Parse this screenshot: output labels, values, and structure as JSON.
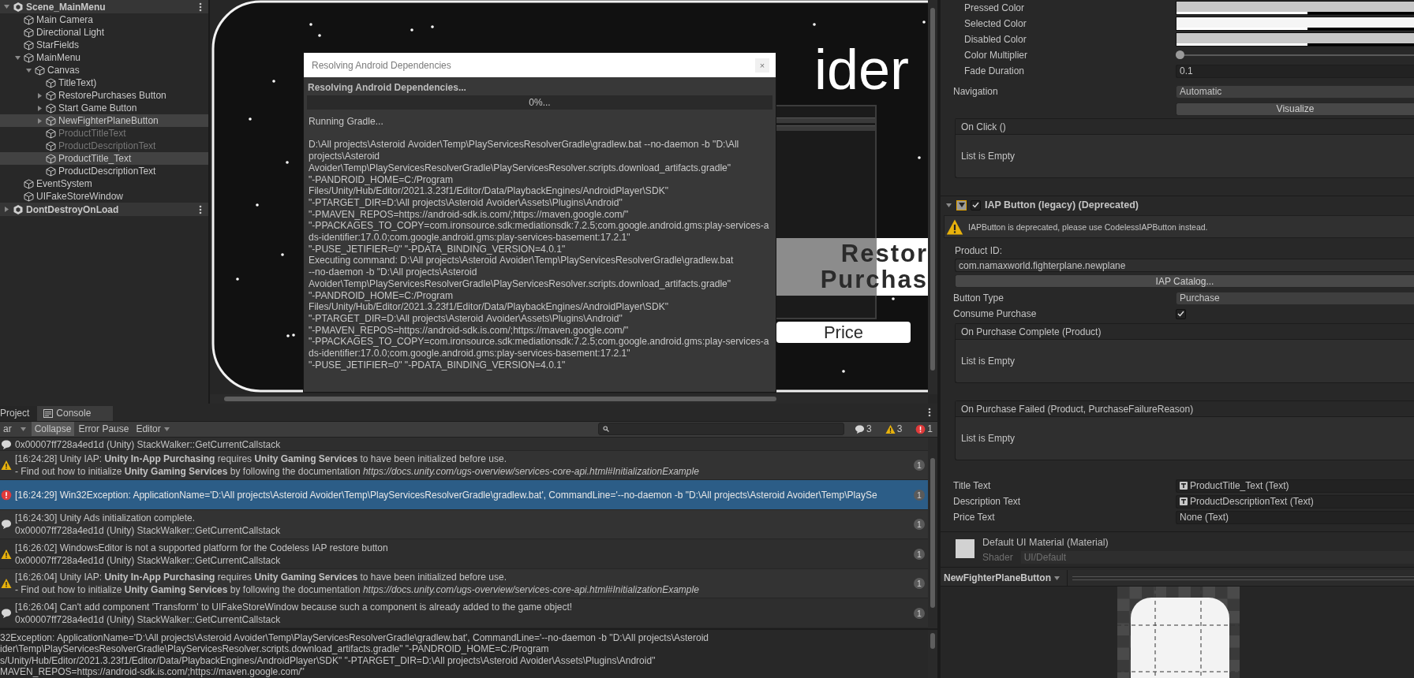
{
  "hierarchy": {
    "scenes": [
      {
        "kind": "scene",
        "name": "Scene_MainMenu",
        "expanded": true,
        "selected": false,
        "children": [
          {
            "kind": "object",
            "name": "Main Camera",
            "selected": false,
            "active": true
          },
          {
            "kind": "object",
            "name": "Directional Light",
            "selected": false,
            "active": true
          },
          {
            "kind": "object",
            "name": "StarFields",
            "selected": false,
            "active": true
          },
          {
            "kind": "object",
            "name": "MainMenu",
            "expanded": true,
            "selected": false,
            "active": true,
            "children": [
              {
                "kind": "object",
                "name": "Canvas",
                "expanded": true,
                "selected": false,
                "active": true,
                "children": [
                  {
                    "kind": "object",
                    "name": "TitleText)",
                    "selected": false,
                    "active": true
                  },
                  {
                    "kind": "object",
                    "name": "RestorePurchases Button",
                    "expanded": false,
                    "selected": false,
                    "active": true
                  },
                  {
                    "kind": "object",
                    "name": "Start Game Button",
                    "expanded": false,
                    "selected": false,
                    "active": true
                  },
                  {
                    "kind": "object",
                    "name": "NewFighterPlaneButton",
                    "expanded": false,
                    "selected": true,
                    "active": true
                  },
                  {
                    "kind": "object",
                    "name": "ProductTitleText",
                    "selected": false,
                    "active": false
                  },
                  {
                    "kind": "object",
                    "name": "ProductDescriptionText",
                    "selected": false,
                    "active": false
                  },
                  {
                    "kind": "object",
                    "name": "ProductTitle_Text",
                    "selected": true,
                    "active": true
                  },
                  {
                    "kind": "object",
                    "name": "ProductDescriptionText",
                    "selected": false,
                    "active": true
                  }
                ]
              }
            ]
          },
          {
            "kind": "object",
            "name": "EventSystem",
            "selected": false,
            "active": true
          },
          {
            "kind": "object",
            "name": "UIFakeStoreWindow",
            "selected": false,
            "active": true
          }
        ]
      },
      {
        "kind": "scene",
        "name": "DontDestroyOnLoad",
        "expanded": false,
        "selected": false
      }
    ]
  },
  "scene_view": {
    "title": "ider",
    "buttons": [
      {
        "kind": "restore",
        "lines": [
          "Restor",
          "Purchas"
        ]
      },
      {
        "kind": "price",
        "lines": [
          "Price"
        ]
      }
    ]
  },
  "dialog": {
    "title": "Resolving Android Dependencies",
    "close": "×",
    "heading": "Resolving Android Dependencies...",
    "progress": {
      "level": 0,
      "label": "0%..."
    },
    "log": [
      "Running Gradle...",
      "D:\\All projects\\Asteroid Avoider\\Temp\\PlayServicesResolverGradle\\gradlew.bat --no-daemon -b \"D:\\All projects\\Asteroid Avoider\\Temp\\PlayServicesResolverGradle\\PlayServicesResolver.scripts.download_artifacts.gradle\" \"-PANDROID_HOME=C:/Program Files/Unity/Hub/Editor/2021.3.23f1/Editor/Data/PlaybackEngines/AndroidPlayer\\SDK\" \"-PTARGET_DIR=D:\\All projects\\Asteroid Avoider\\Assets\\Plugins\\Android\" \"-PMAVEN_REPOS=https://android-sdk.is.com/;https://maven.google.com/\" \"-PPACKAGES_TO_COPY=com.ironsource.sdk:mediationsdk:7.2.5;com.google.android.gms:play-services-ads-identifier:17.0.0;com.google.android.gms:play-services-basement:17.2.1\" \"-PUSE_JETIFIER=0\" \"-PDATA_BINDING_VERSION=4.0.1\"",
      "Executing command: D:\\All projects\\Asteroid Avoider\\Temp\\PlayServicesResolverGradle\\gradlew.bat --no-daemon -b \"D:\\All projects\\Asteroid Avoider\\Temp\\PlayServicesResolverGradle\\PlayServicesResolver.scripts.download_artifacts.gradle\" \"-PANDROID_HOME=C:/Program Files/Unity/Hub/Editor/2021.3.23f1/Editor/Data/PlaybackEngines/AndroidPlayer\\SDK\" \"-PTARGET_DIR=D:\\All projects\\Asteroid Avoider\\Assets\\Plugins\\Android\" \"-PMAVEN_REPOS=https://android-sdk.is.com/;https://maven.google.com/\" \"-PPACKAGES_TO_COPY=com.ironsource.sdk:mediationsdk:7.2.5;com.google.android.gms:play-services-ads-identifier:17.0.0;com.google.android.gms:play-services-basement:17.2.1\" \"-PUSE_JETIFIER=0\" \"-PDATA_BINDING_VERSION=4.0.1\""
    ]
  },
  "console": {
    "tabs": [
      {
        "label": "Project",
        "selected": false
      },
      {
        "label": "Console",
        "selected": true
      }
    ],
    "toolbar": [
      {
        "kind": "button",
        "label": "ar",
        "on": false
      },
      {
        "kind": "caret"
      },
      {
        "kind": "toggle",
        "label": "Collapse",
        "on": true
      },
      {
        "kind": "toggle",
        "label": "Error Pause",
        "on": false
      },
      {
        "kind": "dropdown",
        "label": "Editor"
      }
    ],
    "counts": [
      {
        "kind": "info",
        "count": "3"
      },
      {
        "kind": "warning",
        "count": "3"
      },
      {
        "kind": "error",
        "count": "1"
      }
    ],
    "rows": [
      {
        "kind": "info",
        "selected": false,
        "lines": [
          "0x00007ff728a4ed1d (Unity) StackWalker::GetCurrentCallstack"
        ]
      },
      {
        "kind": "warning",
        "selected": false,
        "count": "1",
        "lines": [
          "[16:24:28] Unity IAP: **Unity In-App Purchasing** requires **Unity Gaming Services** to have been initialized before use.",
          "- Find out how to initialize **Unity Gaming Services** by following the documentation *https://docs.unity.com/ugs-overview/services-core-api.html#InitializationExample*"
        ]
      },
      {
        "kind": "error",
        "selected": true,
        "count": "1",
        "lines": [
          "[16:24:29] Win32Exception: ApplicationName='D:\\All projects\\Asteroid Avoider\\Temp\\PlayServicesResolverGradle\\gradlew.bat', CommandLine='--no-daemon -b \"D:\\All projects\\Asteroid Avoider\\Temp\\PlaySe"
        ]
      },
      {
        "kind": "info",
        "selected": false,
        "count": "1",
        "lines": [
          "[16:24:30] Unity Ads initialization complete.",
          "0x00007ff728a4ed1d (Unity) StackWalker::GetCurrentCallstack"
        ]
      },
      {
        "kind": "warning",
        "selected": false,
        "count": "1",
        "lines": [
          "[16:26:02] WindowsEditor is not a supported platform for the Codeless IAP restore button",
          "0x00007ff728a4ed1d (Unity) StackWalker::GetCurrentCallstack"
        ]
      },
      {
        "kind": "warning",
        "selected": false,
        "count": "1",
        "lines": [
          "[16:26:04] Unity IAP: **Unity In-App Purchasing** requires **Unity Gaming Services** to have been initialized before use.",
          "- Find out how to initialize **Unity Gaming Services** by following the documentation *https://docs.unity.com/ugs-overview/services-core-api.html#InitializationExample*"
        ]
      },
      {
        "kind": "info",
        "selected": false,
        "count": "1",
        "lines": [
          "[16:26:04] Can't add component 'Transform' to UIFakeStoreWindow because such a component is already added to the game object!",
          "0x00007ff728a4ed1d (Unity) StackWalker::GetCurrentCallstack"
        ]
      }
    ],
    "detail": [
      "32Exception: ApplicationName='D:\\All projects\\Asteroid Avoider\\Temp\\PlayServicesResolverGradle\\gradlew.bat', CommandLine='--no-daemon -b \"D:\\All projects\\Asteroid",
      "ider\\Temp\\PlayServicesResolverGradle\\PlayServicesResolver.scripts.download_artifacts.gradle\" \"-PANDROID_HOME=C:/Program",
      "s/Unity/Hub/Editor/2021.3.23f1/Editor/Data/PlaybackEngines/AndroidPlayer\\SDK\" \"-PTARGET_DIR=D:\\All projects\\Asteroid Avoider\\Assets\\Plugins\\Android\"",
      "MAVEN_REPOS=https://android-sdk.is.com/;https://maven.google.com/\""
    ]
  },
  "inspector": {
    "rows": [
      {
        "kind": "group",
        "children": [
          {
            "kind": "color",
            "label": "Pressed Color",
            "color": "#c8c8c8"
          },
          {
            "kind": "color",
            "label": "Selected Color",
            "color": "#f5f5f5"
          },
          {
            "kind": "color",
            "label": "Disabled Color",
            "color": "#c8c8c8"
          },
          {
            "kind": "slider",
            "label": "Color Multiplier",
            "level": 0
          },
          {
            "kind": "field",
            "label": "Fade Duration",
            "value": "0.1"
          }
        ]
      },
      {
        "kind": "dropdown",
        "label": "Navigation",
        "value": "Automatic"
      },
      {
        "kind": "button",
        "label": "Visualize"
      },
      {
        "kind": "event",
        "label": "On Click ()",
        "empty": "List is Empty"
      },
      {
        "kind": "component",
        "label": "IAP Button (legacy) (Deprecated)",
        "expanded": true,
        "enabled": true
      },
      {
        "kind": "warning",
        "text": "IAPButton is deprecated, please use CodelessIAPButton instead."
      },
      {
        "kind": "caption",
        "label": "Product ID:"
      },
      {
        "kind": "text_field",
        "value": "com.namaxworld.fighterplane.newplane"
      },
      {
        "kind": "wide_button",
        "label": "IAP Catalog..."
      },
      {
        "kind": "dropdown",
        "label": "Button Type",
        "value": "Purchase"
      },
      {
        "kind": "checkbox",
        "label": "Consume Purchase",
        "checked": true
      },
      {
        "kind": "event",
        "label": "On Purchase Complete (Product)",
        "empty": "List is Empty"
      },
      {
        "kind": "event",
        "label": "On Purchase Failed (Product, PurchaseFailureReason)",
        "empty": "List is Empty"
      },
      {
        "kind": "object",
        "label": "Title Text",
        "value": "ProductTitle_Text (Text)",
        "assigned": true
      },
      {
        "kind": "object",
        "label": "Description Text",
        "value": "ProductDescriptionText (Text)",
        "assigned": true
      },
      {
        "kind": "object",
        "label": "Price Text",
        "value": "None (Text)",
        "assigned": false
      },
      {
        "kind": "material",
        "title": "Default UI Material (Material)",
        "shader_label": "Shader",
        "shader": "UI/Default"
      }
    ],
    "preview": {
      "title": "NewFighterPlaneButton"
    }
  }
}
